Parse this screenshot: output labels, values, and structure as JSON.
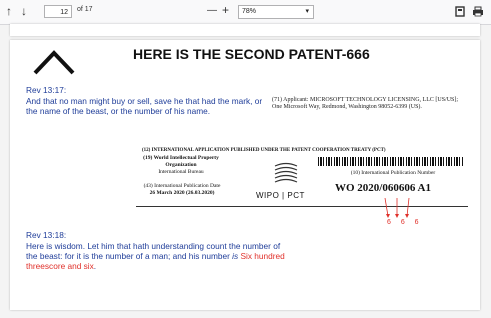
{
  "toolbar": {
    "page_current": "12",
    "page_total": "of 17",
    "zoom_value": "78%",
    "zoom_out": "—",
    "zoom_in": "+"
  },
  "doc": {
    "heading": "HERE IS THE SECOND PATENT-666",
    "rev1_title": "Rev 13:17:",
    "rev1_text": "And that no man might buy or sell, save he that had the mark, or the name of the beast, or the number of his name.",
    "rev2_title": "Rev 13:18:",
    "rev2_text": "Here is wisdom. Let him that hath understanding count the number of the beast: for it is the number of a man; and his number",
    "rev2_is": " is ",
    "rev2_red": "Six hundred threescore and six",
    "rev2_end": ".",
    "applicant": "(71) Applicant: MICROSOFT TECHNOLOGY LICENSING, LLC [US/US]; One Microsoft Way, Redmond, Washington 98052-6399 (US).",
    "pct_header": "(12) INTERNATIONAL APPLICATION PUBLISHED UNDER THE PATENT COOPERATION TREATY (PCT)",
    "org": "(19) World Intellectual Property Organization",
    "bureau": "International Bureau",
    "pubdate_label": "(43) International Publication Date",
    "pubdate": "26 March 2020 (26.03.2020)",
    "pubnum_label": "(10) International Publication Number",
    "wo_number": "WO 2020/060606 A1",
    "wipo": "WIPO | PCT",
    "sixes": "6 6 6"
  },
  "colors": {
    "blue_text": "#1f3d99",
    "red_text": "#e0302a"
  }
}
